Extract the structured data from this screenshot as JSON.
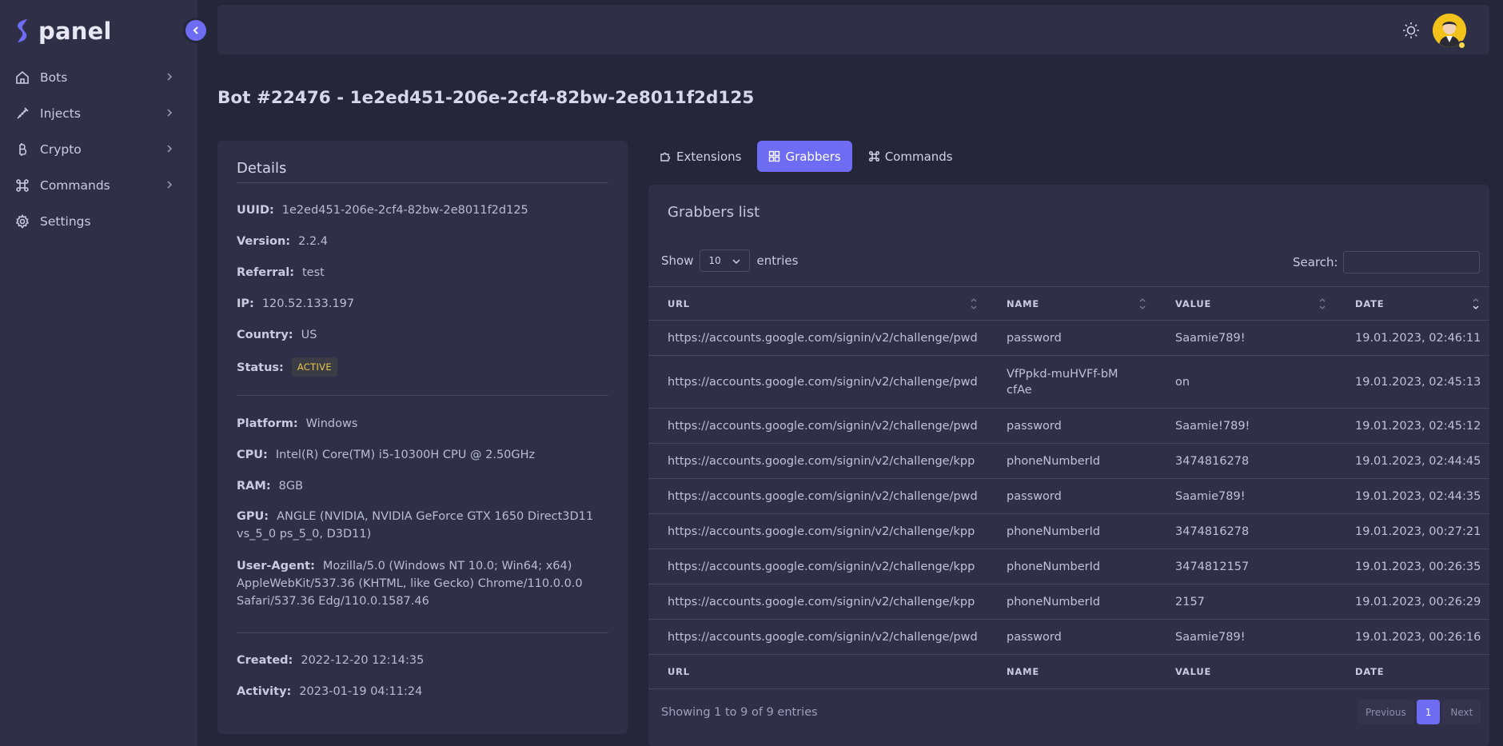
{
  "brand": {
    "name": "panel"
  },
  "sidebar": {
    "items": [
      {
        "label": "Bots",
        "icon": "home-icon",
        "has_chevron": true
      },
      {
        "label": "Injects",
        "icon": "syringe-icon",
        "has_chevron": true
      },
      {
        "label": "Crypto",
        "icon": "bitcoin-icon",
        "has_chevron": true
      },
      {
        "label": "Commands",
        "icon": "command-icon",
        "has_chevron": true
      },
      {
        "label": "Settings",
        "icon": "gear-icon",
        "has_chevron": false
      }
    ]
  },
  "page": {
    "title": "Bot #22476 - 1e2ed451-206e-2cf4-82bw-2e8011f2d125"
  },
  "details": {
    "title": "Details",
    "uuid": {
      "label": "UUID:",
      "value": "1e2ed451-206e-2cf4-82bw-2e8011f2d125"
    },
    "version": {
      "label": "Version:",
      "value": "2.2.4"
    },
    "referral": {
      "label": "Referral:",
      "value": "test"
    },
    "ip": {
      "label": "IP:",
      "value": "120.52.133.197"
    },
    "country": {
      "label": "Country:",
      "value": "US"
    },
    "status": {
      "label": "Status:",
      "value": "ACTIVE"
    },
    "platform": {
      "label": "Platform:",
      "value": "Windows"
    },
    "cpu": {
      "label": "CPU:",
      "value": "Intel(R) Core(TM) i5-10300H CPU @ 2.50GHz"
    },
    "ram": {
      "label": "RAM:",
      "value": "8GB"
    },
    "gpu": {
      "label": "GPU:",
      "value": "ANGLE (NVIDIA, NVIDIA GeForce GTX 1650 Direct3D11 vs_5_0 ps_5_0, D3D11)"
    },
    "user_agent": {
      "label": "User-Agent:",
      "value": "Mozilla/5.0 (Windows NT 10.0; Win64; x64) AppleWebKit/537.36 (KHTML, like Gecko) Chrome/110.0.0.0 Safari/537.36 Edg/110.0.1587.46"
    },
    "created": {
      "label": "Created:",
      "value": "2022-12-20 12:14:35"
    },
    "activity": {
      "label": "Activity:",
      "value": "2023-01-19 04:11:24"
    }
  },
  "tabs": [
    {
      "label": "Extensions",
      "icon": "puzzle-icon",
      "active": false
    },
    {
      "label": "Grabbers",
      "icon": "grid-icon",
      "active": true
    },
    {
      "label": "Commands",
      "icon": "command-icon",
      "active": false
    }
  ],
  "grabbers": {
    "title": "Grabbers list",
    "show_label": "Show",
    "entries_label": "entries",
    "page_size": "10",
    "search_label": "Search:",
    "search_value": "",
    "columns": [
      "URL",
      "NAME",
      "VALUE",
      "DATE"
    ],
    "rows": [
      [
        "https://accounts.google.com/signin/v2/challenge/pwd",
        "password",
        "Saamie789!",
        "19.01.2023, 02:46:11"
      ],
      [
        "https://accounts.google.com/signin/v2/challenge/pwd",
        "VfPpkd-muHVFf-bMcfAe",
        "on",
        "19.01.2023, 02:45:13"
      ],
      [
        "https://accounts.google.com/signin/v2/challenge/pwd",
        "password",
        "Saamie!789!",
        "19.01.2023, 02:45:12"
      ],
      [
        "https://accounts.google.com/signin/v2/challenge/kpp",
        "phoneNumberId",
        "3474816278",
        "19.01.2023, 02:44:45"
      ],
      [
        "https://accounts.google.com/signin/v2/challenge/pwd",
        "password",
        "Saamie789!",
        "19.01.2023, 02:44:35"
      ],
      [
        "https://accounts.google.com/signin/v2/challenge/kpp",
        "phoneNumberId",
        "3474816278",
        "19.01.2023, 00:27:21"
      ],
      [
        "https://accounts.google.com/signin/v2/challenge/kpp",
        "phoneNumberId",
        "3474812157",
        "19.01.2023, 00:26:35"
      ],
      [
        "https://accounts.google.com/signin/v2/challenge/kpp",
        "phoneNumberId",
        "2157",
        "19.01.2023, 00:26:29"
      ],
      [
        "https://accounts.google.com/signin/v2/challenge/pwd",
        "password",
        "Saamie789!",
        "19.01.2023, 00:26:16"
      ]
    ],
    "info": "Showing 1 to 9 of 9 entries",
    "pagination": {
      "previous": "Previous",
      "current": "1",
      "next": "Next"
    }
  },
  "colors": {
    "accent": "#6d6cf3",
    "bg": "#25263a",
    "card": "#2f3047",
    "status": "#e6c64a"
  }
}
